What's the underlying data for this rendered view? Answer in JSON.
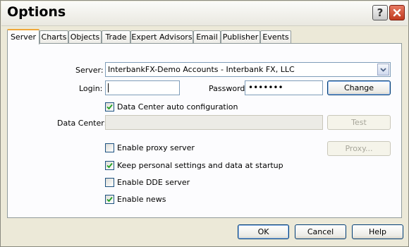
{
  "window": {
    "title": "Options"
  },
  "titlebar": {
    "help_icon": "?",
    "close_icon": "x-icon"
  },
  "tabs": [
    {
      "label": "Server",
      "active": true
    },
    {
      "label": "Charts"
    },
    {
      "label": "Objects"
    },
    {
      "label": "Trade"
    },
    {
      "label": "Expert Advisors"
    },
    {
      "label": "Email"
    },
    {
      "label": "Publisher"
    },
    {
      "label": "Events"
    }
  ],
  "server": {
    "label": "Server:",
    "value": "InterbankFX-Demo Accounts - Interbank FX, LLC"
  },
  "login": {
    "label": "Login:",
    "value": ""
  },
  "password": {
    "label": "Password:",
    "value": "•••••••"
  },
  "change_button": "Change",
  "data_center_auto": {
    "label": "Data Center auto configuration",
    "checked": true
  },
  "data_center": {
    "label": "Data Center:",
    "value": ""
  },
  "test_button": "Test",
  "proxy": {
    "label": "Enable proxy server",
    "checked": false
  },
  "proxy_button": "Proxy...",
  "keep_personal": {
    "label": "Keep personal settings and data at startup",
    "checked": true
  },
  "dde": {
    "label": "Enable DDE server",
    "checked": false
  },
  "news": {
    "label": "Enable news",
    "checked": true
  },
  "footer": {
    "ok": "OK",
    "cancel": "Cancel",
    "help": "Help"
  }
}
